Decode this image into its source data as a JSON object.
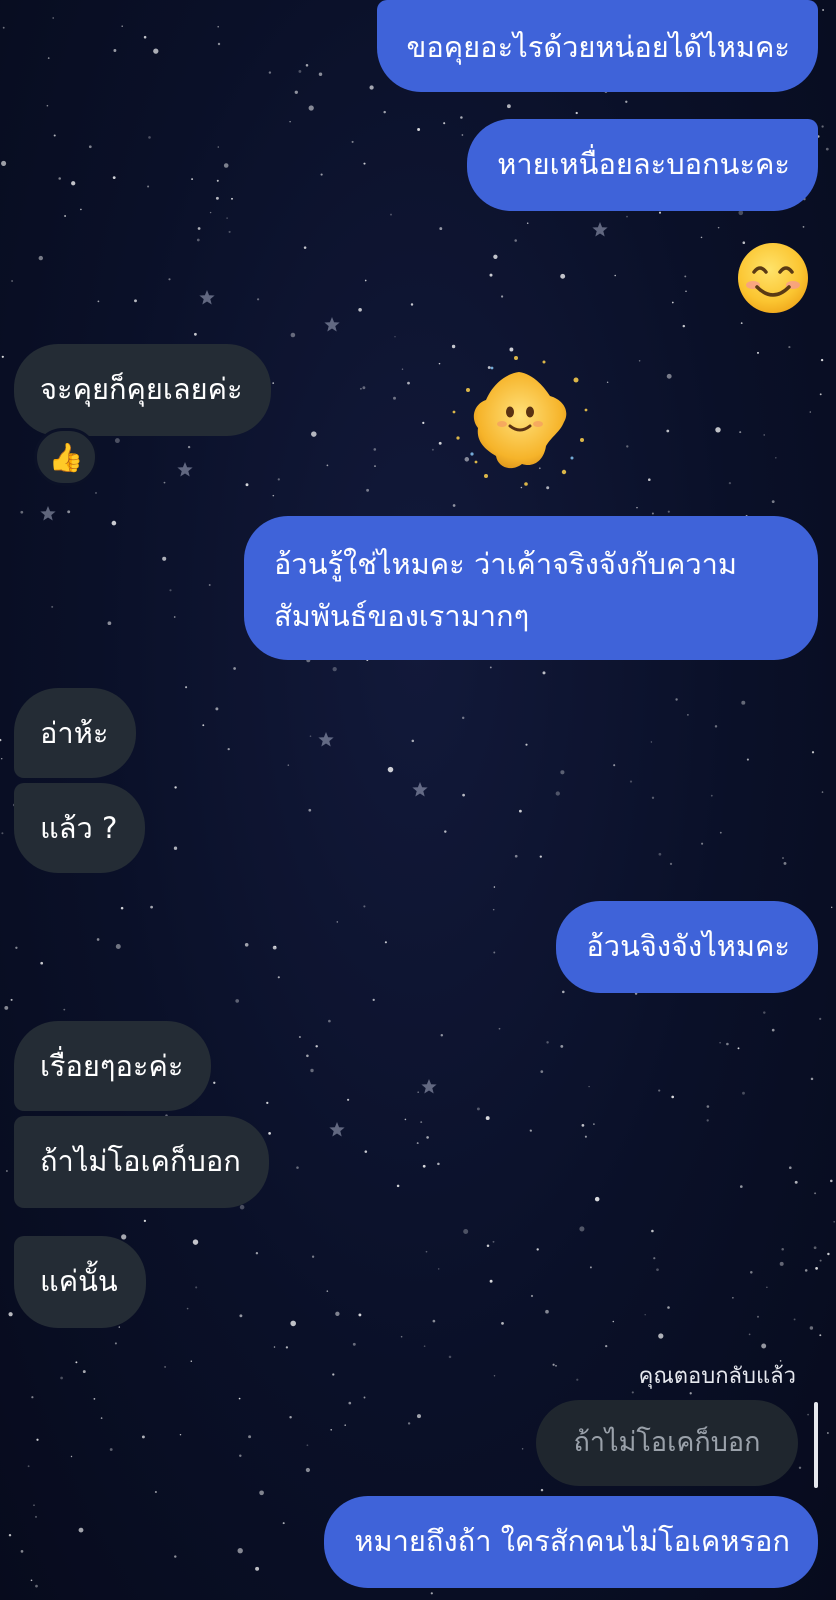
{
  "messages": {
    "m1": "ขอคุยอะไรด้วยหน่อยได้ไหมคะ",
    "m2": "หายเหนื่อยละบอกนะคะ",
    "m3": "😊",
    "m4": "จะคุยก็คุยเลยค่ะ",
    "m4_reaction": "👍",
    "m5": "อ้วนรู้ใช่ไหมคะ ว่าเค้าจริงจังกับความสัมพันธ์ของเรามากๆ",
    "m6": "อ่าห้ะ",
    "m7": "แล้ว ?",
    "m8": "อ้วนจิงจังไหมคะ",
    "m9": "เรื่อยๆอะค่ะ",
    "m10": "ถ้าไม่โอเคก็บอก",
    "m11": "แค่นั้น",
    "reply_label": "คุณตอบกลับแล้ว",
    "reply_quote": "ถ้าไม่โอเคก็บอก",
    "m12": "หมายถึงถ้า ใครสักคนไม่โอเคหรอก"
  },
  "colors": {
    "outgoing_bubble": "#3f63d9",
    "incoming_bubble": "#242c35",
    "background": "#0a1028"
  },
  "icons": {
    "smile": "smiling-face-emoji",
    "thumbs": "thumbs-up-reaction",
    "sticker": "star-character-sticker"
  }
}
